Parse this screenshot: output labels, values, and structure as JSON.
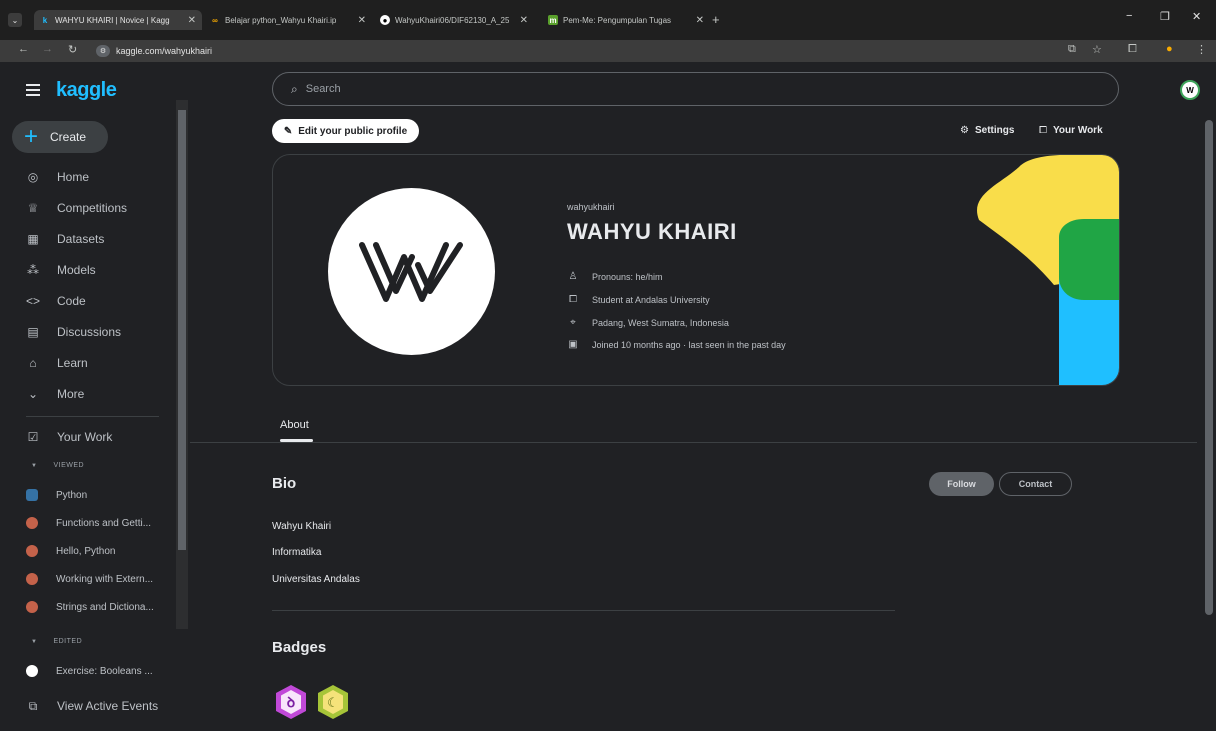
{
  "browser": {
    "tabs": [
      {
        "title": "WAHYU KHAIRI | Novice | Kagg",
        "icon": "kaggle-icon",
        "active": true
      },
      {
        "title": "Belajar python_Wahyu Khairi.ip",
        "icon": "colab-icon",
        "active": false
      },
      {
        "title": "WahyuKhairi06/DIF62130_A_25",
        "icon": "github-icon",
        "active": false
      },
      {
        "title": "Pem-Me: Pengumpulan Tugas",
        "icon": "moodle-icon",
        "active": false
      }
    ],
    "new_tab": "+",
    "url": "kaggle.com/wahyukhairi"
  },
  "sidebar": {
    "brand": "kaggle",
    "create_label": "Create",
    "nav": [
      {
        "label": "Home",
        "icon": "compass-icon"
      },
      {
        "label": "Competitions",
        "icon": "trophy-icon"
      },
      {
        "label": "Datasets",
        "icon": "table-icon"
      },
      {
        "label": "Models",
        "icon": "models-icon"
      },
      {
        "label": "Code",
        "icon": "code-icon"
      },
      {
        "label": "Discussions",
        "icon": "discussion-icon"
      },
      {
        "label": "Learn",
        "icon": "graduation-cap-icon"
      },
      {
        "label": "More",
        "icon": "chevron-down-icon"
      }
    ],
    "your_work": "Your Work",
    "viewed_label": "VIEWED",
    "viewed": [
      {
        "label": "Python"
      },
      {
        "label": "Functions and Getti..."
      },
      {
        "label": "Hello, Python"
      },
      {
        "label": "Working with Extern..."
      },
      {
        "label": "Strings and Dictiona..."
      }
    ],
    "edited_label": "EDITED",
    "edited": [
      {
        "label": "Exercise: Booleans ..."
      }
    ],
    "active_events": "View Active Events"
  },
  "header": {
    "search_placeholder": "Search",
    "edit_profile": "Edit your public profile",
    "settings": "Settings",
    "your_work": "Your Work"
  },
  "profile": {
    "username": "wahyukhairi",
    "name": "WAHYU KHAIRI",
    "pronouns": "Pronouns: he/him",
    "occupation": "Student at Andalas University",
    "location": "Padang, West Sumatra, Indonesia",
    "joined": "Joined 10 months ago · last seen in the past day"
  },
  "tabs": {
    "about": "About"
  },
  "bio": {
    "heading": "Bio",
    "lines": [
      "Wahyu Khairi",
      "Informatika",
      "Universitas Andalas"
    ]
  },
  "actions": {
    "follow": "Follow",
    "contact": "Contact"
  },
  "badges": {
    "heading": "Badges"
  },
  "colors": {
    "brand": "#20beff",
    "deco_yellow": "#f9dd4a",
    "deco_green": "#20a545",
    "deco_blue": "#1fbfff"
  }
}
